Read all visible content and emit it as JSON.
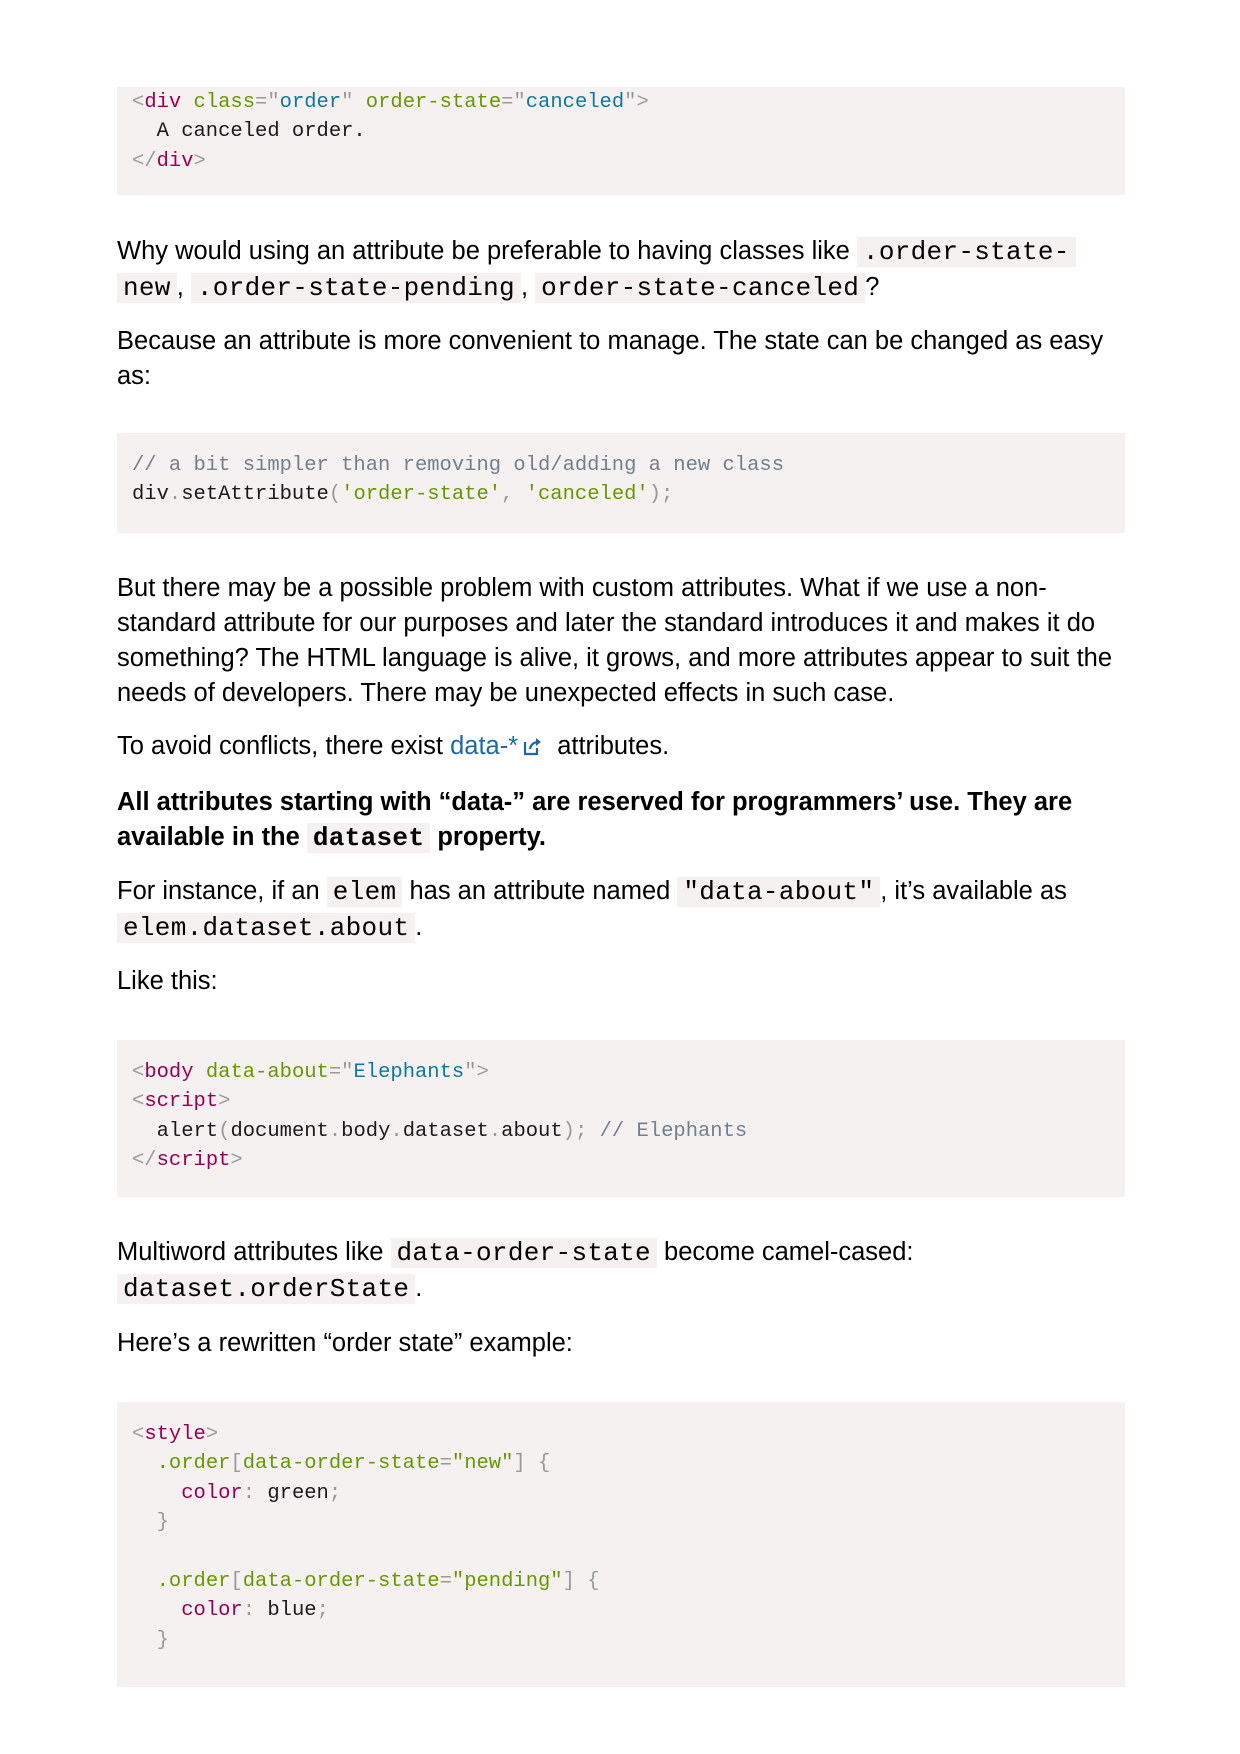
{
  "code1": {
    "lines": [
      [
        [
          "t-punct",
          "<"
        ],
        [
          "t-tag",
          "div"
        ],
        [
          "t-text",
          " "
        ],
        [
          "t-attr",
          "class"
        ],
        [
          "t-punct",
          "=\""
        ],
        [
          "t-val",
          "order"
        ],
        [
          "t-punct",
          "\""
        ],
        [
          "t-text",
          " "
        ],
        [
          "t-attr",
          "order-state"
        ],
        [
          "t-punct",
          "=\""
        ],
        [
          "t-val",
          "canceled"
        ],
        [
          "t-punct",
          "\">"
        ]
      ],
      [
        [
          "t-text",
          "  A canceled order."
        ]
      ],
      [
        [
          "t-punct",
          "</"
        ],
        [
          "t-tag",
          "div"
        ],
        [
          "t-punct",
          ">"
        ]
      ]
    ]
  },
  "p1": {
    "before": "Why would using an attribute be preferable to having classes like ",
    "code_a": ".order-state-",
    "code_a2": "new",
    "sep1": ", ",
    "code_b": ".order-state-pending",
    "sep2": ", ",
    "code_c": "order-state-canceled",
    "after": "?"
  },
  "p2": "Because an attribute is more convenient to manage. The state can be changed as easy as:",
  "code2": {
    "lines": [
      [
        [
          "t-comment",
          "// a bit simpler than removing old/adding a new class"
        ]
      ],
      [
        [
          "t-text",
          "div"
        ],
        [
          "t-punct",
          "."
        ],
        [
          "t-text",
          "setAttribute"
        ],
        [
          "t-punct",
          "("
        ],
        [
          "t-str",
          "'order-state'"
        ],
        [
          "t-punct",
          ", "
        ],
        [
          "t-str",
          "'canceled'"
        ],
        [
          "t-punct",
          ");"
        ]
      ]
    ]
  },
  "p3": "But there may be a possible problem with custom attributes. What if we use a non-standard attribute for our purposes and later the standard introduces it and makes it do something? The HTML language is alive, it grows, and more attributes appear to suit the needs of developers. There may be unexpected effects in such case.",
  "p4": {
    "before": "To avoid conflicts, there exist ",
    "link": "data-*",
    "after": " attributes."
  },
  "p5": {
    "before": "All attributes starting with “data-” are reserved for programmers’ use. They are available in the ",
    "code": "dataset",
    "after": " property."
  },
  "p6": {
    "t1": "For instance, if an ",
    "c1": "elem",
    "t2": " has an attribute named ",
    "c2": "\"data-about\"",
    "t3": ", it’s available as ",
    "c3": "elem.dataset.about",
    "t4": "."
  },
  "p7": "Like this:",
  "code3": {
    "lines": [
      [
        [
          "t-punct",
          "<"
        ],
        [
          "t-tag",
          "body"
        ],
        [
          "t-text",
          " "
        ],
        [
          "t-attr",
          "data-about"
        ],
        [
          "t-punct",
          "=\""
        ],
        [
          "t-val",
          "Elephants"
        ],
        [
          "t-punct",
          "\">"
        ]
      ],
      [
        [
          "t-punct",
          "<"
        ],
        [
          "t-tag",
          "script"
        ],
        [
          "t-punct",
          ">"
        ]
      ],
      [
        [
          "t-text",
          "  alert"
        ],
        [
          "t-punct",
          "("
        ],
        [
          "t-text",
          "document"
        ],
        [
          "t-punct",
          "."
        ],
        [
          "t-text",
          "body"
        ],
        [
          "t-punct",
          "."
        ],
        [
          "t-text",
          "dataset"
        ],
        [
          "t-punct",
          "."
        ],
        [
          "t-text",
          "about"
        ],
        [
          "t-punct",
          ");"
        ],
        [
          "t-text",
          " "
        ],
        [
          "t-comment",
          "// Elephants"
        ]
      ],
      [
        [
          "t-punct",
          "</"
        ],
        [
          "t-tag",
          "script"
        ],
        [
          "t-punct",
          ">"
        ]
      ]
    ]
  },
  "p8": {
    "t1": "Multiword attributes like ",
    "c1": "data-order-state",
    "t2": " become camel-cased: ",
    "c2": "dataset.orderState",
    "t3": "."
  },
  "p9": "Here’s a rewritten “order state” example:",
  "code4": {
    "lines": [
      [
        [
          "t-punct",
          "<"
        ],
        [
          "t-tag",
          "style"
        ],
        [
          "t-punct",
          ">"
        ]
      ],
      [
        [
          "t-text",
          "  "
        ],
        [
          "t-attr",
          ".order"
        ],
        [
          "t-punct",
          "["
        ],
        [
          "t-attr",
          "data-order-state"
        ],
        [
          "t-punct",
          "="
        ],
        [
          "t-str",
          "\"new\""
        ],
        [
          "t-punct",
          "] {"
        ]
      ],
      [
        [
          "t-text",
          "    "
        ],
        [
          "t-prop",
          "color"
        ],
        [
          "t-punct",
          ":"
        ],
        [
          "t-text",
          " green"
        ],
        [
          "t-punct",
          ";"
        ]
      ],
      [
        [
          "t-text",
          "  "
        ],
        [
          "t-punct",
          "}"
        ]
      ],
      [
        [
          "t-text",
          ""
        ]
      ],
      [
        [
          "t-text",
          "  "
        ],
        [
          "t-attr",
          ".order"
        ],
        [
          "t-punct",
          "["
        ],
        [
          "t-attr",
          "data-order-state"
        ],
        [
          "t-punct",
          "="
        ],
        [
          "t-str",
          "\"pending\""
        ],
        [
          "t-punct",
          "] {"
        ]
      ],
      [
        [
          "t-text",
          "    "
        ],
        [
          "t-prop",
          "color"
        ],
        [
          "t-punct",
          ":"
        ],
        [
          "t-text",
          " blue"
        ],
        [
          "t-punct",
          ";"
        ]
      ],
      [
        [
          "t-text",
          "  "
        ],
        [
          "t-punct",
          "}"
        ]
      ]
    ]
  },
  "colors": {
    "code_bg": "#f4f1f0",
    "tag": "#990055",
    "attr": "#669900",
    "value": "#0c7aa0",
    "comment": "#708090",
    "link": "#1b6aa5"
  },
  "icons": {
    "external_link": "external-link-icon"
  }
}
